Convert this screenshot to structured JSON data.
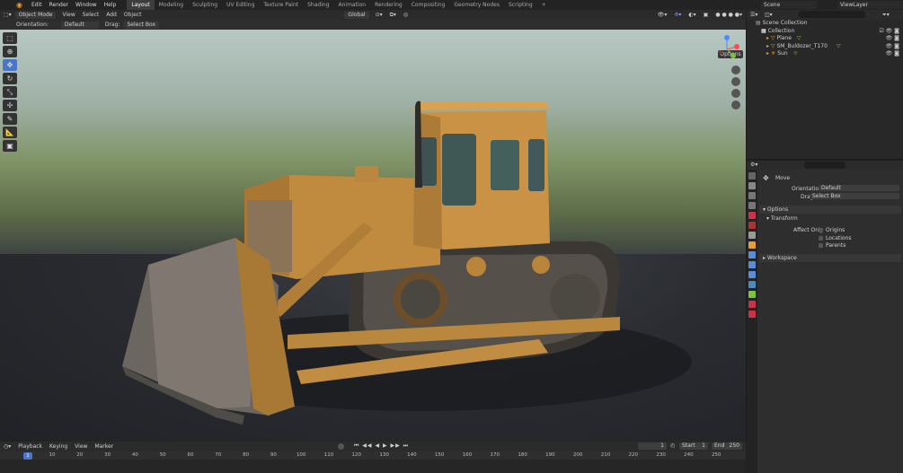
{
  "app": {
    "name": "Blender"
  },
  "menus": [
    "Edit",
    "Render",
    "Window",
    "Help"
  ],
  "workspaces": [
    {
      "label": "Layout",
      "active": true
    },
    {
      "label": "Modeling"
    },
    {
      "label": "Sculpting"
    },
    {
      "label": "UV Editing"
    },
    {
      "label": "Texture Paint"
    },
    {
      "label": "Shading"
    },
    {
      "label": "Animation"
    },
    {
      "label": "Rendering"
    },
    {
      "label": "Compositing"
    },
    {
      "label": "Geometry Nodes"
    },
    {
      "label": "Scripting"
    }
  ],
  "top_right": {
    "scene": "Scene",
    "view_layer": "ViewLayer"
  },
  "viewport_header": {
    "mode": "Object Mode",
    "menus": [
      "View",
      "Select",
      "Add",
      "Object"
    ],
    "transform_orientation": "Global"
  },
  "tool_settings": {
    "orientation_label": "Orientation:",
    "orientation_value": "Default",
    "drag_label": "Drag:",
    "drag_value": "Select Box",
    "options_label": "Options"
  },
  "outliner": {
    "items": [
      {
        "label": "Scene Collection",
        "icon": "scene-collection-icon"
      },
      {
        "label": "Collection",
        "icon": "collection-icon"
      },
      {
        "label": "Plane",
        "icon": "mesh-icon"
      },
      {
        "label": "SM_Buldozer_T170",
        "icon": "mesh-icon"
      },
      {
        "label": "Sun",
        "icon": "light-icon"
      }
    ]
  },
  "properties": {
    "tool_title": "Move",
    "orientation_label": "Orientation",
    "orientation_value": "Default",
    "drag_label": "Drag",
    "drag_value": "Select Box",
    "options_panel": "Options",
    "transform_panel": "Transform",
    "affect_only_label": "Affect Only",
    "affect_options": [
      "Origins",
      "Locations",
      "Parents"
    ],
    "workspace_panel": "Workspace"
  },
  "timeline_header": {
    "menus": [
      "Playback",
      "Keying",
      "View",
      "Marker"
    ],
    "current_frame": "1",
    "start_label": "Start",
    "start_value": "1",
    "end_label": "End",
    "end_value": "250"
  },
  "timeline_ruler": [
    "1",
    "10",
    "20",
    "30",
    "40",
    "50",
    "60",
    "70",
    "80",
    "90",
    "100",
    "110",
    "120",
    "130",
    "140",
    "150",
    "160",
    "170",
    "180",
    "190",
    "200",
    "210",
    "220",
    "230",
    "240",
    "250"
  ],
  "colors": {
    "accent": "#4a76c8",
    "bulldozer": "#c98f3a",
    "active_tab": "#3d3d3d"
  }
}
